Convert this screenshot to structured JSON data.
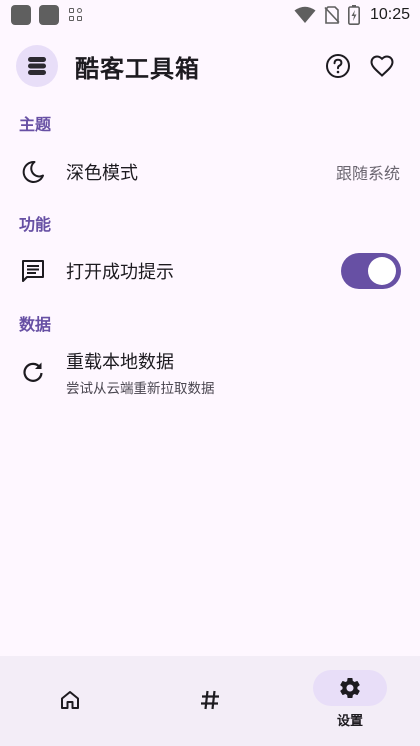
{
  "status_bar": {
    "time": "10:25",
    "icons": [
      "notification-square-icon",
      "notification-square-icon",
      "grid-app-icon",
      "wifi-icon",
      "no-sim-icon",
      "battery-charging-icon"
    ]
  },
  "header": {
    "title": "酷客工具箱",
    "avatar_icon": "stack-layers-icon",
    "actions": [
      "help-icon",
      "favorite-heart-icon"
    ]
  },
  "sections": {
    "theme": {
      "title": "主题",
      "dark_mode": {
        "label": "深色模式",
        "value": "跟随系统",
        "icon": "moon-icon"
      }
    },
    "features": {
      "title": "功能",
      "success_tip": {
        "label": "打开成功提示",
        "enabled": true,
        "icon": "message-lines-icon"
      }
    },
    "data": {
      "title": "数据",
      "reload": {
        "label": "重载本地数据",
        "description": "尝试从云端重新拉取数据",
        "icon": "refresh-icon"
      }
    }
  },
  "bottom_nav": {
    "items": [
      {
        "icon": "home-icon",
        "label": ""
      },
      {
        "icon": "hash-icon",
        "label": ""
      },
      {
        "icon": "settings-gear-icon",
        "label": "设置",
        "active": true
      }
    ]
  },
  "colors": {
    "background": "#FEF7FF",
    "accent": "#6750A4",
    "accent_container": "#E8DEF8",
    "nav_background": "#F3EDF7"
  }
}
